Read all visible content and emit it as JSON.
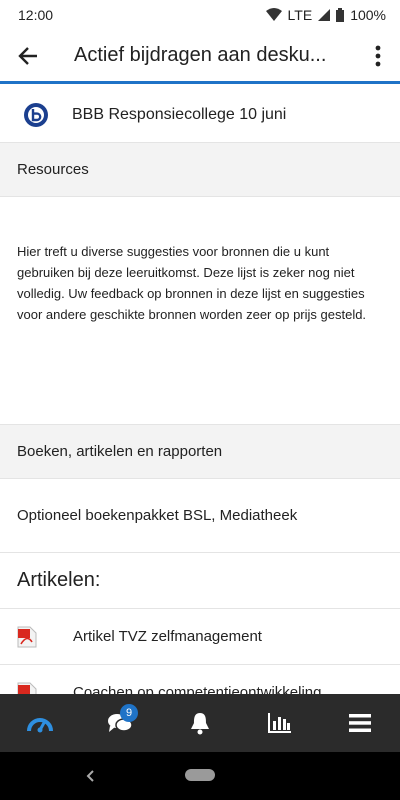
{
  "status_bar": {
    "time": "12:00",
    "network": "LTE",
    "battery": "100%"
  },
  "app_bar": {
    "title": "Actief bijdragen aan desku..."
  },
  "bbb_link": {
    "label": "BBB Responsiecollege 10 juni",
    "icon": "bigbluebutton-icon"
  },
  "resources": {
    "heading": "Resources",
    "description": "Hier treft u diverse suggesties voor bronnen die u kunt gebruiken bij deze leeruitkomst. Deze lijst is zeker nog niet volledig. Uw feedback op bronnen in deze lijst en suggesties voor andere geschikte bronnen worden zeer op prijs gesteld."
  },
  "books": {
    "heading": "Boeken, artikelen en rapporten",
    "item": "Optioneel boekenpakket BSL, Mediatheek"
  },
  "articles": {
    "heading": "Artikelen:",
    "items": [
      {
        "label": "Artikel TVZ zelfmanagement",
        "icon": "pdf-icon"
      },
      {
        "label": "Coachen op competentieontwikkeling",
        "icon": "pdf-icon"
      }
    ]
  },
  "bottom_nav": {
    "messages_badge": "9"
  },
  "colors": {
    "accent": "#1f73c7",
    "bottom_nav_bg": "#2b2b2b",
    "pdf_red": "#d9281e"
  }
}
